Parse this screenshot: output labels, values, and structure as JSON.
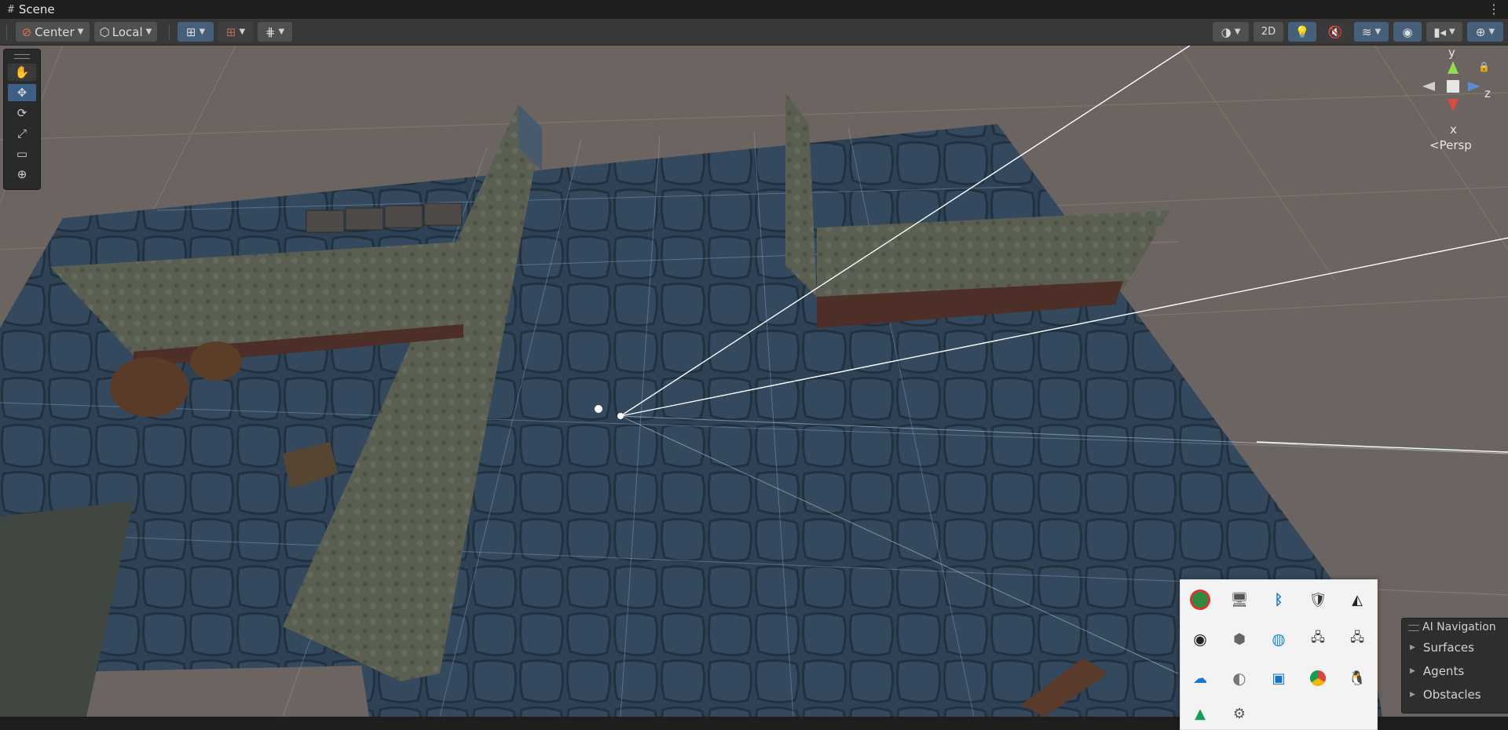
{
  "window": {
    "tab_title": "Scene",
    "tab_icon": "grid-icon"
  },
  "toolbar": {
    "pivot_label": "Center",
    "space_label": "Local",
    "view_2d_label": "2D"
  },
  "tools": [
    "hand-tool",
    "move-tool",
    "rotate-tool",
    "scale-tool",
    "rect-tool",
    "transform-tool"
  ],
  "gizmo": {
    "y": "y",
    "z": "z",
    "x": "x",
    "projection": "Persp"
  },
  "ai_navigation": {
    "title": "AI Navigation",
    "items": [
      {
        "label": "Surfaces"
      },
      {
        "label": "Agents"
      },
      {
        "label": "Obstacles"
      }
    ]
  },
  "tray_icons": [
    "app-icon",
    "display-icon",
    "bluetooth-icon",
    "security-shield-icon",
    "sound-icon",
    "sync-icon",
    "cube-icon",
    "edge-icon",
    "network-icon",
    "network-icon-2",
    "onedrive-icon",
    "steam-icon",
    "monitor-icon",
    "chrome-icon",
    "mascot-icon",
    "drive-icon",
    "gear-icon"
  ],
  "colors": {
    "selected_tool": "#3d5f86",
    "floor": "#2d3f52",
    "background": "#6b6460"
  }
}
